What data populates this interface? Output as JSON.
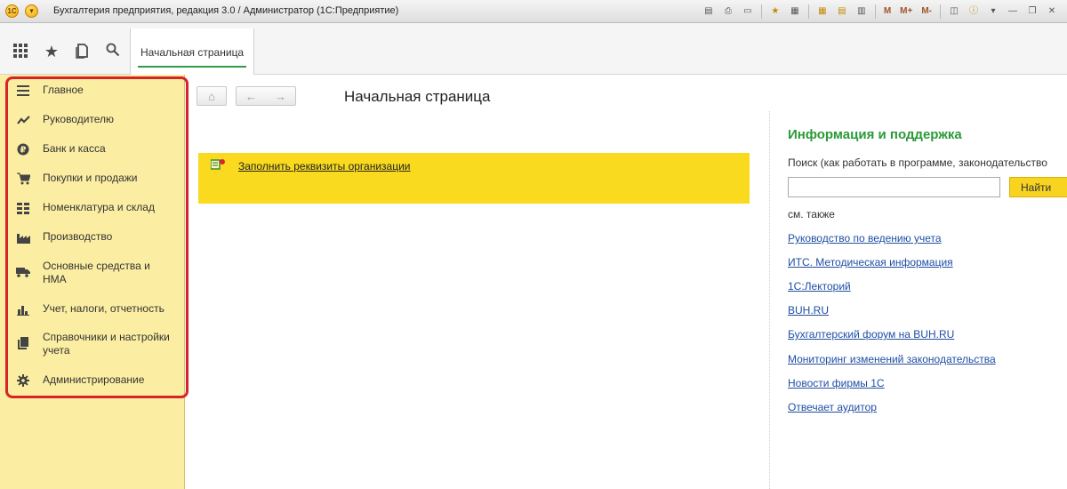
{
  "window": {
    "title": "Бухгалтерия предприятия, редакция 3.0 / Администратор  (1С:Предприятие)",
    "logo_glyph": "1С",
    "buttons": [
      {
        "name": "save-icon",
        "glyph": "▤"
      },
      {
        "name": "print-icon",
        "glyph": "⎙"
      },
      {
        "name": "preview-icon",
        "glyph": "▭"
      },
      {
        "name": "favorites-icon",
        "glyph": "★"
      },
      {
        "name": "history-icon",
        "glyph": "▦"
      },
      {
        "name": "calendar-icon",
        "glyph": "▦"
      },
      {
        "name": "calculator-icon",
        "glyph": "▤"
      },
      {
        "name": "document-icon",
        "glyph": "▥"
      }
    ],
    "memory_buttons": [
      "M",
      "M+",
      "M-"
    ],
    "controls": [
      {
        "name": "panel-icon",
        "glyph": "◫"
      },
      {
        "name": "info-icon",
        "glyph": "ⓘ"
      },
      {
        "name": "dropdown-icon",
        "glyph": "▾"
      },
      {
        "name": "minimize-icon",
        "glyph": "—"
      },
      {
        "name": "restore-icon",
        "glyph": "❐"
      },
      {
        "name": "close-icon",
        "glyph": "✕"
      }
    ]
  },
  "toolbar": {
    "apps_glyph": "⁝⁝⁝",
    "favorites_glyph": "★",
    "history_glyph": "⧉",
    "search_glyph": "⚲",
    "tab_label": "Начальная страница"
  },
  "sidebar": {
    "items": [
      {
        "label": "Главное",
        "icon": "menu-icon"
      },
      {
        "label": "Руководителю",
        "icon": "trend-icon"
      },
      {
        "label": "Банк и касса",
        "icon": "ruble-icon"
      },
      {
        "label": "Покупки и продажи",
        "icon": "cart-icon"
      },
      {
        "label": "Номенклатура и склад",
        "icon": "grid-icon"
      },
      {
        "label": "Производство",
        "icon": "factory-icon"
      },
      {
        "label": "Основные средства и НМА",
        "icon": "truck-icon"
      },
      {
        "label": "Учет, налоги, отчетность",
        "icon": "bar-chart-icon"
      },
      {
        "label": "Справочники и настройки учета",
        "icon": "books-icon"
      },
      {
        "label": "Администрирование",
        "icon": "gear-icon"
      }
    ]
  },
  "main": {
    "home_glyph": "⌂",
    "back_glyph": "←",
    "forward_glyph": "→",
    "page_title": "Начальная страница",
    "banner_link": "Заполнить реквизиты организации",
    "colors": {
      "banner": "#fada1f",
      "sidebar": "#fbeea2",
      "highlight_frame": "#d8232a"
    }
  },
  "info": {
    "title": "Информация и поддержка",
    "search_label": "Поиск (как работать в программе, законодательство",
    "search_value": "",
    "find_button": "Найти",
    "see_also": "см. также",
    "links": [
      "Руководство по ведению учета",
      "ИТС. Методическая информация",
      "1С:Лекторий",
      "BUH.RU",
      "Бухгалтерский форум на BUH.RU",
      "Мониторинг изменений законодательства",
      "Новости фирмы 1С",
      "Отвечает аудитор"
    ],
    "colors": {
      "title": "#2a9a38",
      "link": "#1f4ea3",
      "find_button": "#f8d320"
    }
  }
}
